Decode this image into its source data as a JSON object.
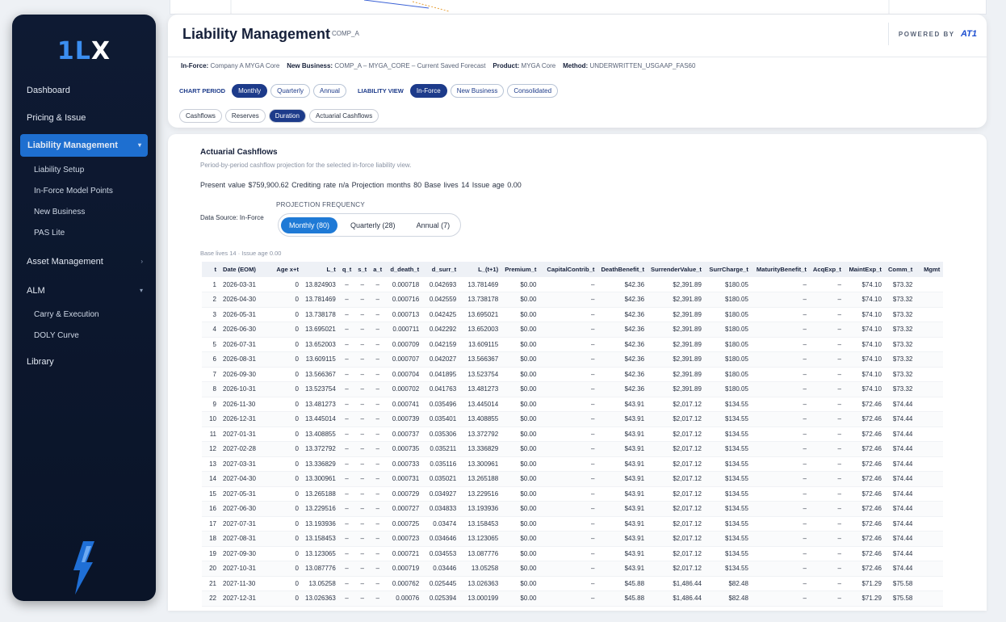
{
  "sidebar": {
    "logo_num": "1L",
    "logo_x": "X",
    "items": [
      {
        "label": "Dashboard"
      },
      {
        "label": "Pricing & Issue"
      },
      {
        "label": "Liability Management"
      },
      {
        "label": "Asset Management"
      },
      {
        "label": "ALM"
      },
      {
        "label": "Library"
      }
    ],
    "liability_sub": [
      "Liability Setup",
      "In-Force Model Points",
      "New Business",
      "PAS Lite"
    ],
    "alm_sub": [
      "Carry & Execution",
      "DOLY Curve"
    ]
  },
  "header": {
    "title": "Liability Management",
    "subtitle": "COMP_A",
    "powered_by": "POWERED BY",
    "powered_brand": "AT1",
    "meta": {
      "inforce_label": "In-Force:",
      "inforce_value": "Company A MYGA Core",
      "nb_label": "New Business:",
      "nb_value": "COMP_A – MYGA_CORE – Current Saved Forecast",
      "product_label": "Product:",
      "product_value": "MYGA Core",
      "method_label": "Method:",
      "method_value": "UNDERWRITTEN_USGAAP_FAS60"
    },
    "chart_period_label": "CHART PERIOD",
    "periods": [
      "Monthly",
      "Quarterly",
      "Annual"
    ],
    "liability_view_label": "LIABILITY VIEW",
    "views": [
      "In-Force",
      "New Business",
      "Consolidated"
    ],
    "tabs": [
      "Cashflows",
      "Reserves",
      "Duration",
      "Actuarial Cashflows"
    ]
  },
  "content": {
    "title": "Actuarial Cashflows",
    "description": "Period-by-period cashflow projection for the selected in-force liability view.",
    "stats": "Present value $759,900.62   Crediting rate n/a   Projection months 80   Base lives 14   Issue age 0.00",
    "data_source": "Data Source: In-Force",
    "projection_label": "PROJECTION FREQUENCY",
    "freq": [
      "Monthly (80)",
      "Quarterly (28)",
      "Annual (7)"
    ],
    "note": "Base lives 14 · Issue age 0.00"
  },
  "table": {
    "headers": [
      "t",
      "Date (EOM)",
      "Age x+t",
      "L_t",
      "q_t",
      "s_t",
      "a_t",
      "d_death_t",
      "d_surr_t",
      "L_(t+1)",
      "Premium_t",
      "CapitalContrib_t",
      "DeathBenefit_t",
      "SurrenderValue_t",
      "SurrCharge_t",
      "MaturityBenefit_t",
      "AcqExp_t",
      "MaintExp_t",
      "Comm_t",
      "Mgmt"
    ],
    "rows": [
      [
        "1",
        "2026-03-31",
        "0",
        "13.824903",
        "–",
        "–",
        "–",
        "0.000718",
        "0.042693",
        "13.781469",
        "$0.00",
        "–",
        "$42.36",
        "$2,391.89",
        "$180.05",
        "–",
        "–",
        "$74.10",
        "$73.32",
        ""
      ],
      [
        "2",
        "2026-04-30",
        "0",
        "13.781469",
        "–",
        "–",
        "–",
        "0.000716",
        "0.042559",
        "13.738178",
        "$0.00",
        "–",
        "$42.36",
        "$2,391.89",
        "$180.05",
        "–",
        "–",
        "$74.10",
        "$73.32",
        ""
      ],
      [
        "3",
        "2026-05-31",
        "0",
        "13.738178",
        "–",
        "–",
        "–",
        "0.000713",
        "0.042425",
        "13.695021",
        "$0.00",
        "–",
        "$42.36",
        "$2,391.89",
        "$180.05",
        "–",
        "–",
        "$74.10",
        "$73.32",
        ""
      ],
      [
        "4",
        "2026-06-30",
        "0",
        "13.695021",
        "–",
        "–",
        "–",
        "0.000711",
        "0.042292",
        "13.652003",
        "$0.00",
        "–",
        "$42.36",
        "$2,391.89",
        "$180.05",
        "–",
        "–",
        "$74.10",
        "$73.32",
        ""
      ],
      [
        "5",
        "2026-07-31",
        "0",
        "13.652003",
        "–",
        "–",
        "–",
        "0.000709",
        "0.042159",
        "13.609115",
        "$0.00",
        "–",
        "$42.36",
        "$2,391.89",
        "$180.05",
        "–",
        "–",
        "$74.10",
        "$73.32",
        ""
      ],
      [
        "6",
        "2026-08-31",
        "0",
        "13.609115",
        "–",
        "–",
        "–",
        "0.000707",
        "0.042027",
        "13.566367",
        "$0.00",
        "–",
        "$42.36",
        "$2,391.89",
        "$180.05",
        "–",
        "–",
        "$74.10",
        "$73.32",
        ""
      ],
      [
        "7",
        "2026-09-30",
        "0",
        "13.566367",
        "–",
        "–",
        "–",
        "0.000704",
        "0.041895",
        "13.523754",
        "$0.00",
        "–",
        "$42.36",
        "$2,391.89",
        "$180.05",
        "–",
        "–",
        "$74.10",
        "$73.32",
        ""
      ],
      [
        "8",
        "2026-10-31",
        "0",
        "13.523754",
        "–",
        "–",
        "–",
        "0.000702",
        "0.041763",
        "13.481273",
        "$0.00",
        "–",
        "$42.36",
        "$2,391.89",
        "$180.05",
        "–",
        "–",
        "$74.10",
        "$73.32",
        ""
      ],
      [
        "9",
        "2026-11-30",
        "0",
        "13.481273",
        "–",
        "–",
        "–",
        "0.000741",
        "0.035496",
        "13.445014",
        "$0.00",
        "–",
        "$43.91",
        "$2,017.12",
        "$134.55",
        "–",
        "–",
        "$72.46",
        "$74.44",
        ""
      ],
      [
        "10",
        "2026-12-31",
        "0",
        "13.445014",
        "–",
        "–",
        "–",
        "0.000739",
        "0.035401",
        "13.408855",
        "$0.00",
        "–",
        "$43.91",
        "$2,017.12",
        "$134.55",
        "–",
        "–",
        "$72.46",
        "$74.44",
        ""
      ],
      [
        "11",
        "2027-01-31",
        "0",
        "13.408855",
        "–",
        "–",
        "–",
        "0.000737",
        "0.035306",
        "13.372792",
        "$0.00",
        "–",
        "$43.91",
        "$2,017.12",
        "$134.55",
        "–",
        "–",
        "$72.46",
        "$74.44",
        ""
      ],
      [
        "12",
        "2027-02-28",
        "0",
        "13.372792",
        "–",
        "–",
        "–",
        "0.000735",
        "0.035211",
        "13.336829",
        "$0.00",
        "–",
        "$43.91",
        "$2,017.12",
        "$134.55",
        "–",
        "–",
        "$72.46",
        "$74.44",
        ""
      ],
      [
        "13",
        "2027-03-31",
        "0",
        "13.336829",
        "–",
        "–",
        "–",
        "0.000733",
        "0.035116",
        "13.300961",
        "$0.00",
        "–",
        "$43.91",
        "$2,017.12",
        "$134.55",
        "–",
        "–",
        "$72.46",
        "$74.44",
        ""
      ],
      [
        "14",
        "2027-04-30",
        "0",
        "13.300961",
        "–",
        "–",
        "–",
        "0.000731",
        "0.035021",
        "13.265188",
        "$0.00",
        "–",
        "$43.91",
        "$2,017.12",
        "$134.55",
        "–",
        "–",
        "$72.46",
        "$74.44",
        ""
      ],
      [
        "15",
        "2027-05-31",
        "0",
        "13.265188",
        "–",
        "–",
        "–",
        "0.000729",
        "0.034927",
        "13.229516",
        "$0.00",
        "–",
        "$43.91",
        "$2,017.12",
        "$134.55",
        "–",
        "–",
        "$72.46",
        "$74.44",
        ""
      ],
      [
        "16",
        "2027-06-30",
        "0",
        "13.229516",
        "–",
        "–",
        "–",
        "0.000727",
        "0.034833",
        "13.193936",
        "$0.00",
        "–",
        "$43.91",
        "$2,017.12",
        "$134.55",
        "–",
        "–",
        "$72.46",
        "$74.44",
        ""
      ],
      [
        "17",
        "2027-07-31",
        "0",
        "13.193936",
        "–",
        "–",
        "–",
        "0.000725",
        "0.03474",
        "13.158453",
        "$0.00",
        "–",
        "$43.91",
        "$2,017.12",
        "$134.55",
        "–",
        "–",
        "$72.46",
        "$74.44",
        ""
      ],
      [
        "18",
        "2027-08-31",
        "0",
        "13.158453",
        "–",
        "–",
        "–",
        "0.000723",
        "0.034646",
        "13.123065",
        "$0.00",
        "–",
        "$43.91",
        "$2,017.12",
        "$134.55",
        "–",
        "–",
        "$72.46",
        "$74.44",
        ""
      ],
      [
        "19",
        "2027-09-30",
        "0",
        "13.123065",
        "–",
        "–",
        "–",
        "0.000721",
        "0.034553",
        "13.087776",
        "$0.00",
        "–",
        "$43.91",
        "$2,017.12",
        "$134.55",
        "–",
        "–",
        "$72.46",
        "$74.44",
        ""
      ],
      [
        "20",
        "2027-10-31",
        "0",
        "13.087776",
        "–",
        "–",
        "–",
        "0.000719",
        "0.03446",
        "13.05258",
        "$0.00",
        "–",
        "$43.91",
        "$2,017.12",
        "$134.55",
        "–",
        "–",
        "$72.46",
        "$74.44",
        ""
      ],
      [
        "21",
        "2027-11-30",
        "0",
        "13.05258",
        "–",
        "–",
        "–",
        "0.000762",
        "0.025445",
        "13.026363",
        "$0.00",
        "–",
        "$45.88",
        "$1,486.44",
        "$82.48",
        "–",
        "–",
        "$71.29",
        "$75.58",
        ""
      ],
      [
        "22",
        "2027-12-31",
        "0",
        "13.026363",
        "–",
        "–",
        "–",
        "0.00076",
        "0.025394",
        "13.000199",
        "$0.00",
        "–",
        "$45.88",
        "$1,486.44",
        "$82.48",
        "–",
        "–",
        "$71.29",
        "$75.58",
        ""
      ]
    ]
  }
}
